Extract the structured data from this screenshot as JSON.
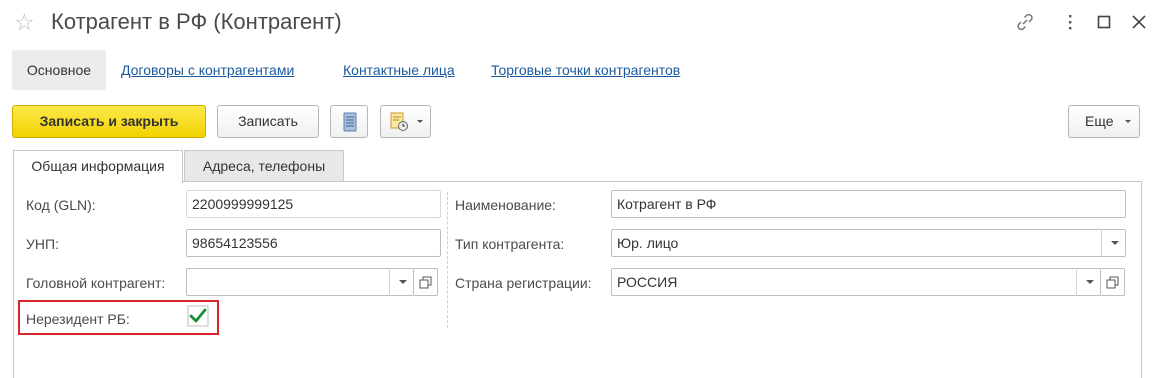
{
  "window": {
    "title": "Котрагент в РФ (Контрагент)",
    "icons": [
      "star-icon",
      "link-icon",
      "more-vert-icon",
      "maximize-icon",
      "close-icon"
    ]
  },
  "nav": {
    "active": "Основное",
    "links": [
      "Договоры с контрагентами",
      "Контактные лица",
      "Торговые точки контрагентов"
    ]
  },
  "toolbar": {
    "save_close": "Записать и закрыть",
    "save": "Записать",
    "more": "Еще",
    "icons": [
      "document-list-icon",
      "report-print-icon"
    ]
  },
  "tabs": {
    "general": "Общая информация",
    "addresses": "Адреса, телефоны"
  },
  "form": {
    "code_label": "Код (GLN):",
    "code_value": "2200999999125",
    "unp_label": "УНП:",
    "unp_value": "98654123556",
    "head_label": "Головной контрагент:",
    "head_value": "",
    "nonres_label": "Нерезидент РБ:",
    "nonres_checked": true,
    "name_label": "Наименование:",
    "name_value": "Котрагент в РФ",
    "type_label": "Тип контрагента:",
    "type_value": "Юр. лицо",
    "country_label": "Страна регистрации:",
    "country_value": "РОССИЯ"
  },
  "colors": {
    "primary_button": "#f2d200",
    "link": "#1a5a9c",
    "highlight_box": "#d9262c",
    "checkmark": "#1e8c3a"
  }
}
